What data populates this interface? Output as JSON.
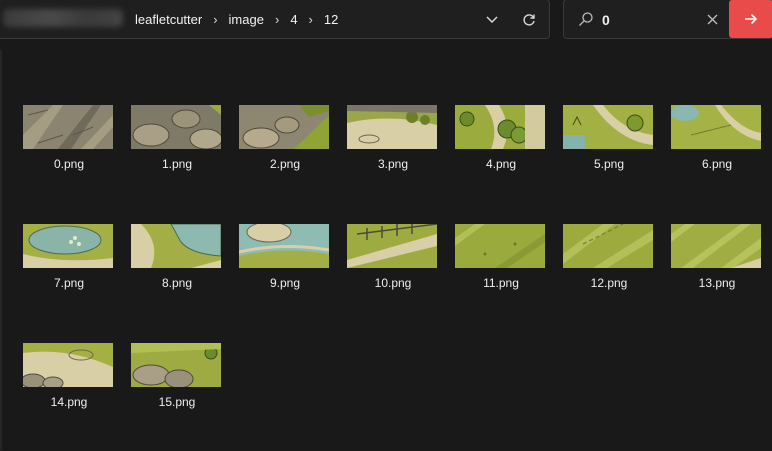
{
  "pathbar": {
    "crumbs": [
      "leafletcutter",
      "image",
      "4",
      "12"
    ],
    "separator": "›",
    "dropdown_icon": "chevron-down-icon",
    "refresh_icon": "refresh-icon"
  },
  "search": {
    "value": "0",
    "search_icon": "search-icon",
    "clear_icon": "close-icon",
    "go_icon": "arrow-right-icon",
    "accent": "#e94b4b"
  },
  "files": [
    {
      "name": "0.png"
    },
    {
      "name": "1.png"
    },
    {
      "name": "2.png"
    },
    {
      "name": "3.png"
    },
    {
      "name": "4.png"
    },
    {
      "name": "5.png"
    },
    {
      "name": "6.png"
    },
    {
      "name": "7.png"
    },
    {
      "name": "8.png"
    },
    {
      "name": "9.png"
    },
    {
      "name": "10.png"
    },
    {
      "name": "11.png"
    },
    {
      "name": "12.png"
    },
    {
      "name": "13.png"
    },
    {
      "name": "14.png"
    },
    {
      "name": "15.png"
    }
  ]
}
